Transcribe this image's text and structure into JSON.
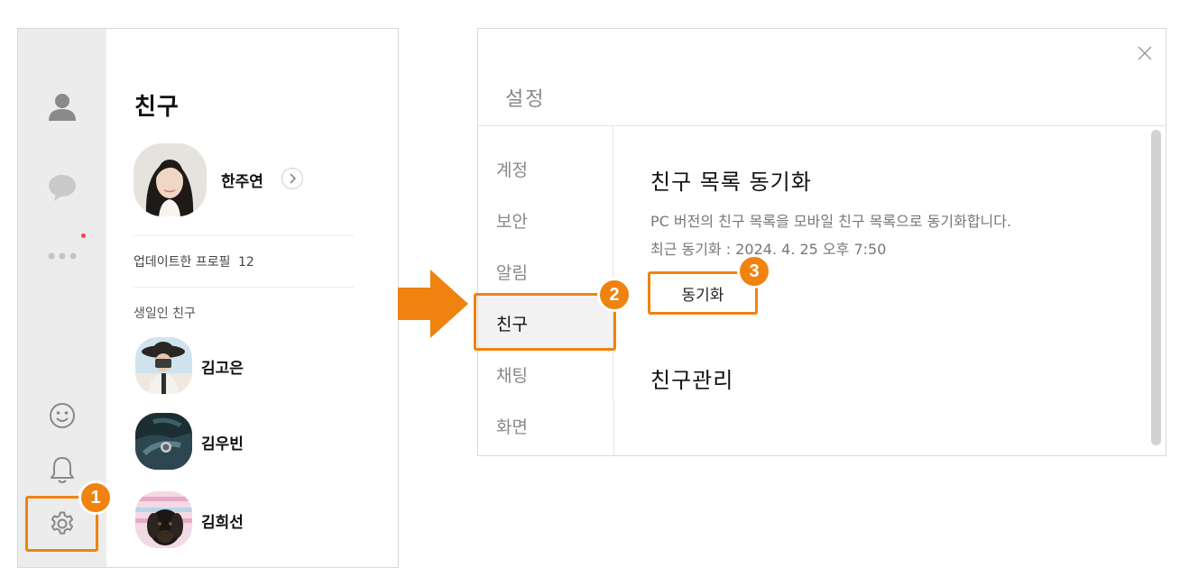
{
  "left_window": {
    "friends_title": "친구",
    "profile": {
      "name": "한주연"
    },
    "updated_profiles_label": "업데이트한 프로필",
    "updated_profiles_count": "12",
    "birthday_header": "생일인 친구",
    "birthday_friends": [
      {
        "name": "김고은"
      },
      {
        "name": "김우빈"
      },
      {
        "name": "김희선"
      }
    ],
    "rail_icons": [
      "person-icon",
      "chat-bubble-icon",
      "more-icon",
      "emoji-icon",
      "bell-icon",
      "gear-icon"
    ]
  },
  "right_window": {
    "title": "설정",
    "nav": [
      {
        "label": "계정"
      },
      {
        "label": "보안"
      },
      {
        "label": "알림"
      },
      {
        "label": "친구",
        "active": true
      },
      {
        "label": "채팅"
      },
      {
        "label": "화면"
      }
    ],
    "sync_section": {
      "title": "친구 목록 동기화",
      "description": "PC 버전의 친구 목록을 모바일 친구 목록으로 동기화합니다.",
      "recent_sync": "최근 동기화 : 2024. 4. 25 오후 7:50",
      "button_label": "동기화"
    },
    "manage_section": {
      "title": "친구관리"
    }
  },
  "step_badges": [
    "1",
    "2",
    "3"
  ],
  "colors": {
    "accent": "#f0820f",
    "rail_bg": "#ececec",
    "notification_dot": "#f04848"
  }
}
